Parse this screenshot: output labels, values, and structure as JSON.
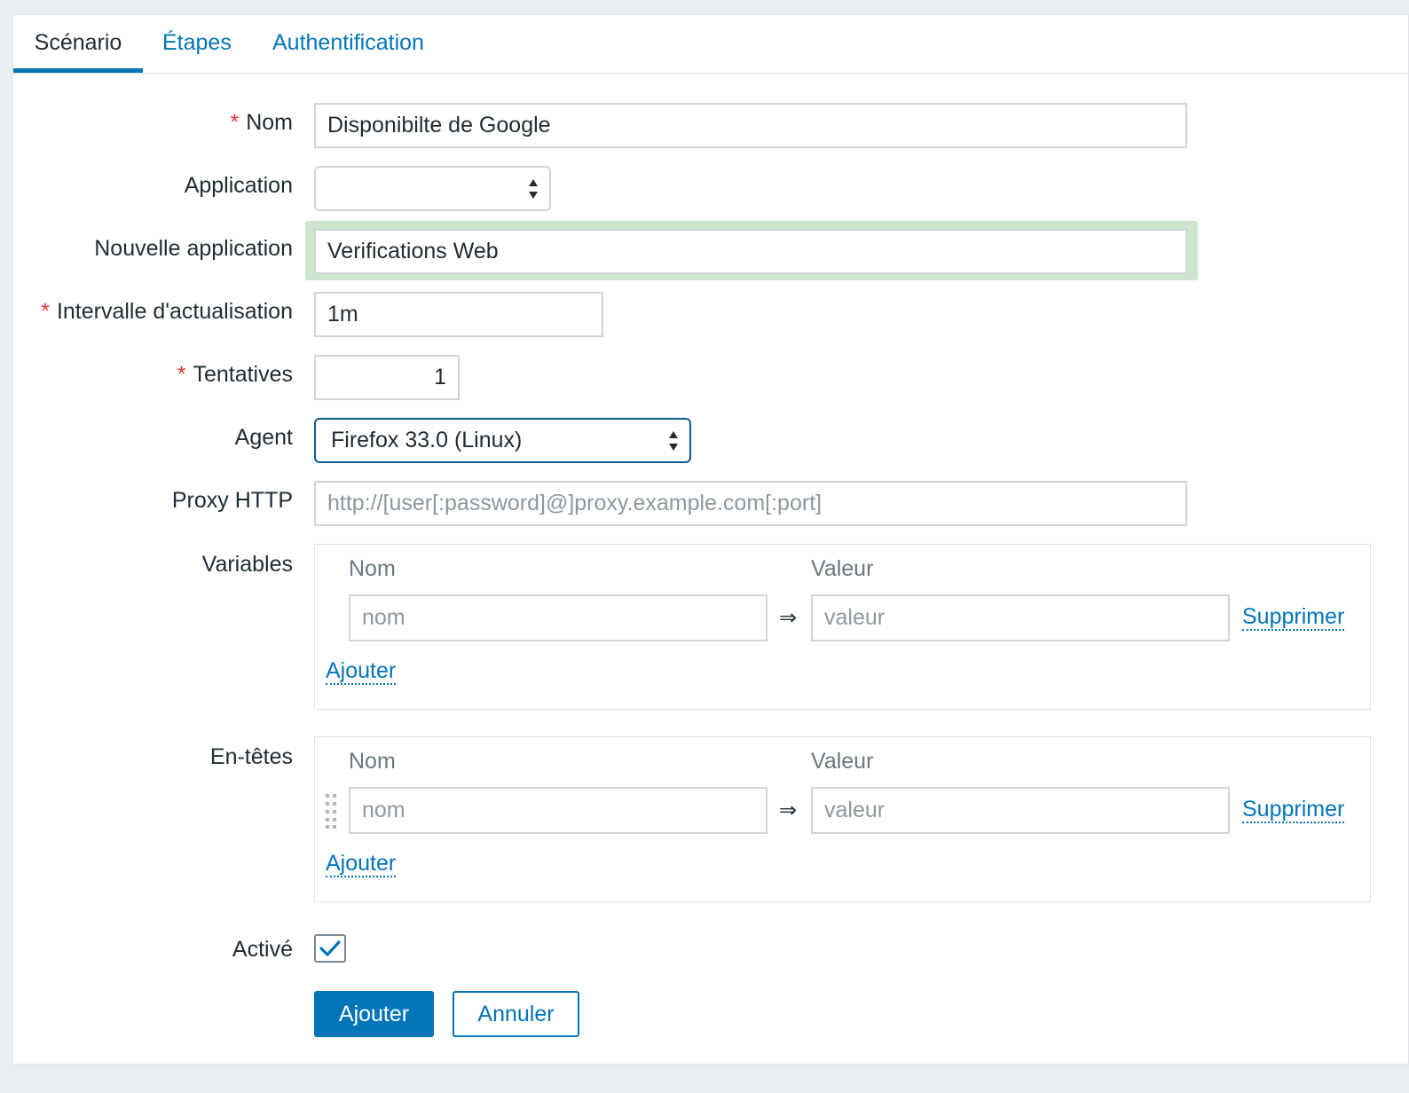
{
  "tabs": [
    {
      "label": "Scénario",
      "active": true
    },
    {
      "label": "Étapes",
      "active": false
    },
    {
      "label": "Authentification",
      "active": false
    }
  ],
  "form": {
    "required_marker": "*",
    "name": {
      "label": "Nom",
      "value": "Disponibilte de Google"
    },
    "application": {
      "label": "Application",
      "value": ""
    },
    "new_application": {
      "label": "Nouvelle application",
      "value": "Verifications Web"
    },
    "update_interval": {
      "label": "Intervalle d'actualisation",
      "value": "1m"
    },
    "attempts": {
      "label": "Tentatives",
      "value": "1"
    },
    "agent": {
      "label": "Agent",
      "value": "Firefox 33.0 (Linux)"
    },
    "http_proxy": {
      "label": "Proxy HTTP",
      "placeholder": "http://[user[:password]@]proxy.example.com[:port]"
    },
    "variables": {
      "label": "Variables",
      "col_name": "Nom",
      "col_value": "Valeur",
      "row": {
        "name_placeholder": "nom",
        "value_placeholder": "valeur",
        "arrow": "⇒",
        "remove_label": "Supprimer"
      },
      "add_label": "Ajouter"
    },
    "headers": {
      "label": "En-têtes",
      "col_name": "Nom",
      "col_value": "Valeur",
      "row": {
        "name_placeholder": "nom",
        "value_placeholder": "valeur",
        "arrow": "⇒",
        "remove_label": "Supprimer"
      },
      "add_label": "Ajouter"
    },
    "enabled": {
      "label": "Activé",
      "checked": true
    }
  },
  "buttons": {
    "add_label": "Ajouter",
    "cancel_label": "Annuler"
  },
  "colors": {
    "accent": "#0275b8",
    "required": "#e33734",
    "focus_highlight": "#cce5cc"
  }
}
